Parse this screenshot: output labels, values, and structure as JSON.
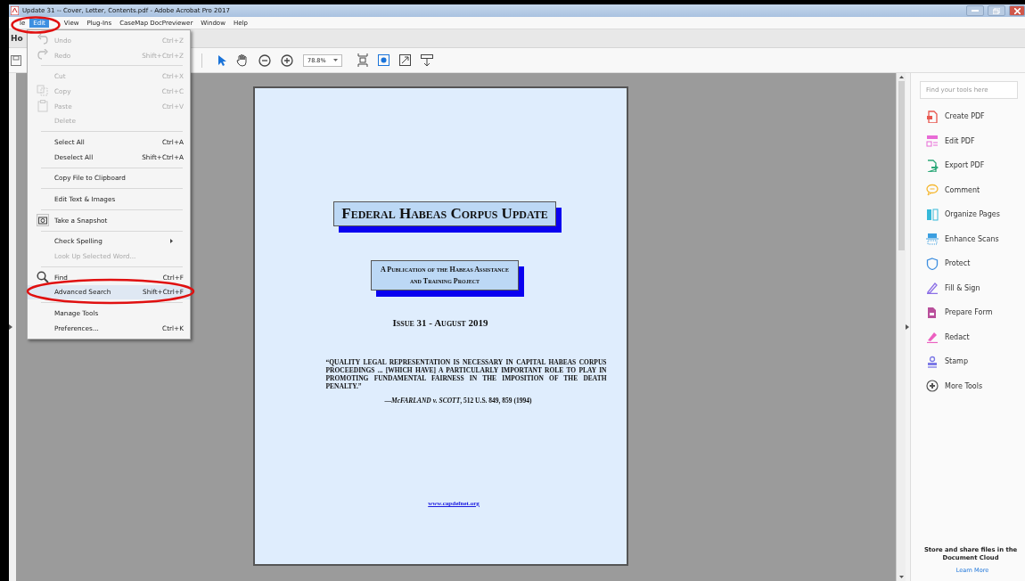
{
  "window": {
    "title": "Update 31 -- Cover, Letter, Contents.pdf - Adobe Acrobat Pro 2017"
  },
  "menu_bar": [
    {
      "label": "le",
      "selected": false
    },
    {
      "label": "Edit",
      "selected": true
    },
    {
      "label": "View",
      "selected": false
    },
    {
      "label": "Plug-Ins",
      "selected": false
    },
    {
      "label": "CaseMap DocPreviewer",
      "selected": false
    },
    {
      "label": "Window",
      "selected": false
    },
    {
      "label": "Help",
      "selected": false
    }
  ],
  "tab_bar": {
    "label": "Ho"
  },
  "toolbar": {
    "zoom": "78.8%"
  },
  "edit_menu": [
    {
      "kind": "item",
      "label": "Undo",
      "shortcut": "Ctrl+Z",
      "disabled": true,
      "selected": false
    },
    {
      "kind": "item",
      "label": "Redo",
      "shortcut": "Shift+Ctrl+Z",
      "disabled": true,
      "selected": false
    },
    {
      "kind": "separator"
    },
    {
      "kind": "item",
      "label": "Cut",
      "shortcut": "Ctrl+X",
      "disabled": true,
      "selected": false
    },
    {
      "kind": "item",
      "label": "Copy",
      "shortcut": "Ctrl+C",
      "disabled": true,
      "selected": false
    },
    {
      "kind": "item",
      "label": "Paste",
      "shortcut": "Ctrl+V",
      "disabled": true,
      "selected": false
    },
    {
      "kind": "item",
      "label": "Delete",
      "disabled": true,
      "selected": false
    },
    {
      "kind": "separator"
    },
    {
      "kind": "item",
      "label": "Select All",
      "shortcut": "Ctrl+A",
      "disabled": false,
      "selected": false
    },
    {
      "kind": "item",
      "label": "Deselect All",
      "shortcut": "Shift+Ctrl+A",
      "disabled": false,
      "selected": false
    },
    {
      "kind": "separator"
    },
    {
      "kind": "item",
      "label": "Copy File to Clipboard",
      "disabled": false,
      "selected": false
    },
    {
      "kind": "separator"
    },
    {
      "kind": "item",
      "label": "Edit Text & Images",
      "disabled": false,
      "selected": false
    },
    {
      "kind": "separator"
    },
    {
      "kind": "item",
      "label": "Take a Snapshot",
      "disabled": false,
      "selected": false
    },
    {
      "kind": "separator"
    },
    {
      "kind": "item",
      "label": "Check Spelling",
      "disabled": false,
      "selected": false,
      "submenu": true
    },
    {
      "kind": "item",
      "label": "Look Up Selected Word...",
      "disabled": true,
      "selected": false
    },
    {
      "kind": "separator"
    },
    {
      "kind": "item",
      "label": "Find",
      "shortcut": "Ctrl+F",
      "disabled": false,
      "selected": false
    },
    {
      "kind": "item",
      "label": "Advanced Search",
      "shortcut": "Shift+Ctrl+F",
      "disabled": false,
      "selected": true
    },
    {
      "kind": "separator"
    },
    {
      "kind": "item",
      "label": "Manage Tools",
      "disabled": false,
      "selected": false
    },
    {
      "kind": "item",
      "label": "Preferences...",
      "shortcut": "Ctrl+K",
      "disabled": false,
      "selected": false
    }
  ],
  "document": {
    "title": "Federal Habeas Corpus Update",
    "subtitle_lines": [
      "A Publication of the Habeas Assistance",
      "and Training Project"
    ],
    "issue": "Issue 31 - August 2019",
    "quote": "“QUALITY LEGAL REPRESENTATION IS NECESSARY IN CAPITAL HABEAS CORPUS PROCEEDINGS ... [WHICH HAVE] A PARTICULARLY IMPORTANT ROLE TO PLAY IN PROMOTING FUNDAMENTAL FAIRNESS IN THE IMPOSITION OF THE DEATH PENALTY.”",
    "citation": "—*McFARLAND v. SCOTT*, 512 U.S. 849, 859 (1994)",
    "link": "www.capdefnet.org"
  },
  "tools_pane": {
    "search": {
      "placeholder": "Find your tools here"
    },
    "tools": [
      {
        "label": "Create PDF",
        "color": "#e8574f"
      },
      {
        "label": "Edit PDF",
        "color": "#e86ad6"
      },
      {
        "label": "Export PDF",
        "color": "#2ea97a"
      },
      {
        "label": "Comment",
        "color": "#f5b730"
      },
      {
        "label": "Organize Pages",
        "color": "#36b9d9"
      },
      {
        "label": "Enhance Scans",
        "color": "#3a9ee0"
      },
      {
        "label": "Protect",
        "color": "#3f8fe0"
      },
      {
        "label": "Fill & Sign",
        "color": "#8c6fe6"
      },
      {
        "label": "Prepare Form",
        "color": "#b94f9b"
      },
      {
        "label": "Redact",
        "color": "#ec5fc0"
      },
      {
        "label": "Stamp",
        "color": "#7b78e6"
      },
      {
        "label": "More Tools",
        "color": "#555555"
      }
    ],
    "cloud_text": "Store and share files in the Document Cloud",
    "learn_more": "Learn More"
  }
}
